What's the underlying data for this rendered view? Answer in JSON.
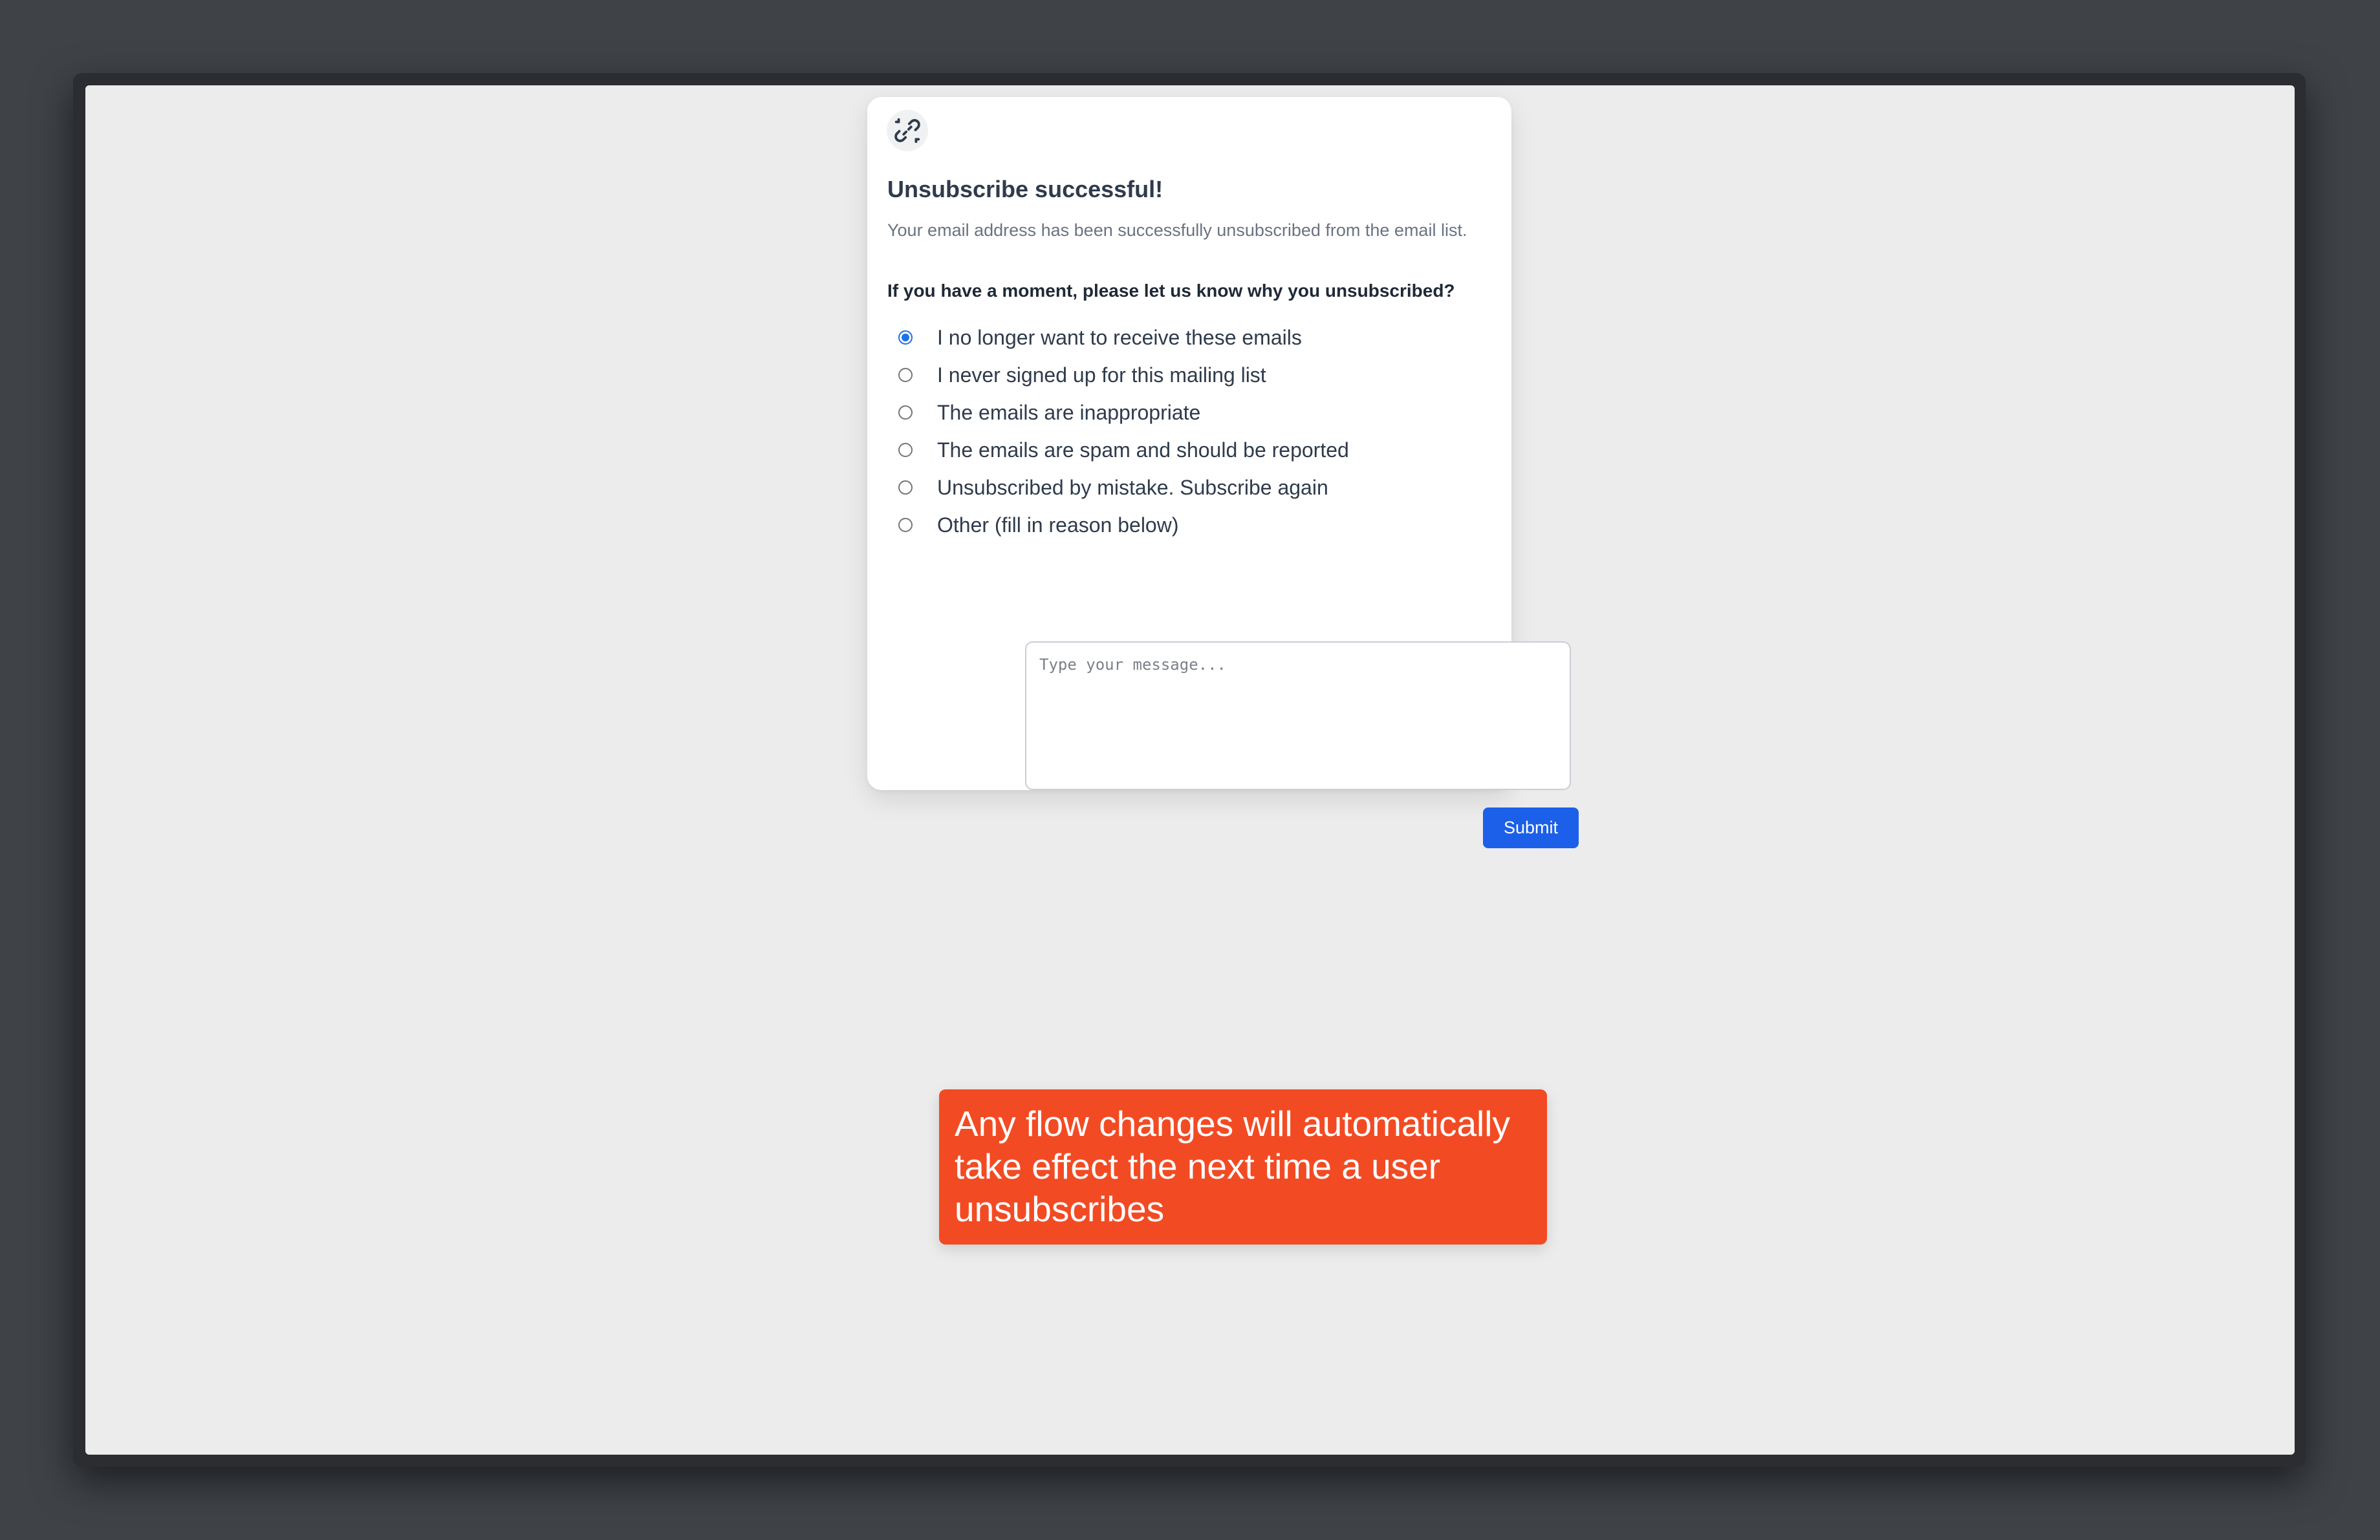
{
  "card": {
    "title": "Unsubscribe successful!",
    "description": "Your email address has been successfully unsubscribed from the email list.",
    "question": "If you have a moment, please let us know why you unsubscribed?",
    "options": [
      {
        "label": "I no longer want to receive these emails",
        "checked": true
      },
      {
        "label": "I never signed up for this mailing list",
        "checked": false
      },
      {
        "label": "The emails are inappropriate",
        "checked": false
      },
      {
        "label": "The emails are spam and should be reported",
        "checked": false
      },
      {
        "label": "Unsubscribed by mistake. Subscribe again",
        "checked": false
      },
      {
        "label": "Other (fill in reason below)",
        "checked": false
      }
    ],
    "message_placeholder": "Type your message...",
    "submit_label": "Submit"
  },
  "banner": {
    "text": "Any flow changes will automatically take effect the next time a user unsubscribes"
  },
  "colors": {
    "accent": "#1c5fe8",
    "banner": "#f24b24"
  },
  "icons": {
    "logo": "broken-link-icon"
  }
}
